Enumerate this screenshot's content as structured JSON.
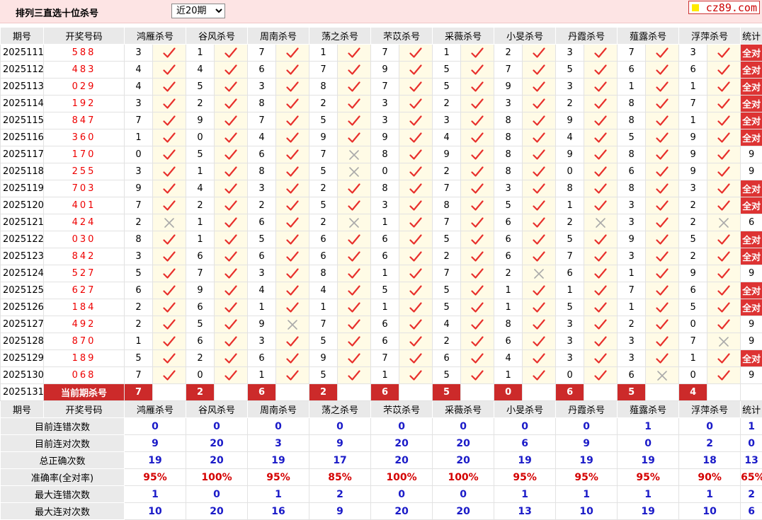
{
  "title": "排列三直选十位杀号",
  "period_select": {
    "value": "近20期",
    "options": [
      "近20期"
    ]
  },
  "logo": "cz89.com",
  "header": {
    "period": "期号",
    "draw": "开奖号码",
    "experts": [
      "鸿雁杀号",
      "谷风杀号",
      "周南杀号",
      "荡之杀号",
      "芣苡杀号",
      "采薇杀号",
      "小旻杀号",
      "丹霞杀号",
      "薤露杀号",
      "浮萍杀号"
    ],
    "stat": "统计"
  },
  "rows": [
    {
      "period": "2025111",
      "draw": "588",
      "kills": [
        [
          "3",
          true
        ],
        [
          "1",
          true
        ],
        [
          "7",
          true
        ],
        [
          "1",
          true
        ],
        [
          "7",
          true
        ],
        [
          "1",
          true
        ],
        [
          "2",
          true
        ],
        [
          "3",
          true
        ],
        [
          "7",
          true
        ],
        [
          "3",
          true
        ]
      ],
      "stat": "全对"
    },
    {
      "period": "2025112",
      "draw": "483",
      "kills": [
        [
          "4",
          true
        ],
        [
          "4",
          true
        ],
        [
          "6",
          true
        ],
        [
          "7",
          true
        ],
        [
          "9",
          true
        ],
        [
          "5",
          true
        ],
        [
          "7",
          true
        ],
        [
          "5",
          true
        ],
        [
          "6",
          true
        ],
        [
          "6",
          true
        ]
      ],
      "stat": "全对"
    },
    {
      "period": "2025113",
      "draw": "029",
      "kills": [
        [
          "4",
          true
        ],
        [
          "5",
          true
        ],
        [
          "3",
          true
        ],
        [
          "8",
          true
        ],
        [
          "7",
          true
        ],
        [
          "5",
          true
        ],
        [
          "9",
          true
        ],
        [
          "3",
          true
        ],
        [
          "1",
          true
        ],
        [
          "1",
          true
        ]
      ],
      "stat": "全对"
    },
    {
      "period": "2025114",
      "draw": "192",
      "kills": [
        [
          "3",
          true
        ],
        [
          "2",
          true
        ],
        [
          "8",
          true
        ],
        [
          "2",
          true
        ],
        [
          "3",
          true
        ],
        [
          "2",
          true
        ],
        [
          "3",
          true
        ],
        [
          "2",
          true
        ],
        [
          "8",
          true
        ],
        [
          "7",
          true
        ]
      ],
      "stat": "全对"
    },
    {
      "period": "2025115",
      "draw": "847",
      "kills": [
        [
          "7",
          true
        ],
        [
          "9",
          true
        ],
        [
          "7",
          true
        ],
        [
          "5",
          true
        ],
        [
          "3",
          true
        ],
        [
          "3",
          true
        ],
        [
          "8",
          true
        ],
        [
          "9",
          true
        ],
        [
          "8",
          true
        ],
        [
          "1",
          true
        ]
      ],
      "stat": "全对"
    },
    {
      "period": "2025116",
      "draw": "360",
      "kills": [
        [
          "1",
          true
        ],
        [
          "0",
          true
        ],
        [
          "4",
          true
        ],
        [
          "9",
          true
        ],
        [
          "9",
          true
        ],
        [
          "4",
          true
        ],
        [
          "8",
          true
        ],
        [
          "4",
          true
        ],
        [
          "5",
          true
        ],
        [
          "9",
          true
        ]
      ],
      "stat": "全对"
    },
    {
      "period": "2025117",
      "draw": "170",
      "kills": [
        [
          "0",
          true
        ],
        [
          "5",
          true
        ],
        [
          "6",
          true
        ],
        [
          "7",
          false
        ],
        [
          "8",
          true
        ],
        [
          "9",
          true
        ],
        [
          "8",
          true
        ],
        [
          "9",
          true
        ],
        [
          "8",
          true
        ],
        [
          "9",
          true
        ]
      ],
      "stat": "9"
    },
    {
      "period": "2025118",
      "draw": "255",
      "kills": [
        [
          "3",
          true
        ],
        [
          "1",
          true
        ],
        [
          "8",
          true
        ],
        [
          "5",
          false
        ],
        [
          "0",
          true
        ],
        [
          "2",
          true
        ],
        [
          "8",
          true
        ],
        [
          "0",
          true
        ],
        [
          "6",
          true
        ],
        [
          "9",
          true
        ]
      ],
      "stat": "9"
    },
    {
      "period": "2025119",
      "draw": "703",
      "kills": [
        [
          "9",
          true
        ],
        [
          "4",
          true
        ],
        [
          "3",
          true
        ],
        [
          "2",
          true
        ],
        [
          "8",
          true
        ],
        [
          "7",
          true
        ],
        [
          "3",
          true
        ],
        [
          "8",
          true
        ],
        [
          "8",
          true
        ],
        [
          "3",
          true
        ]
      ],
      "stat": "全对"
    },
    {
      "period": "2025120",
      "draw": "401",
      "kills": [
        [
          "7",
          true
        ],
        [
          "2",
          true
        ],
        [
          "2",
          true
        ],
        [
          "5",
          true
        ],
        [
          "3",
          true
        ],
        [
          "8",
          true
        ],
        [
          "5",
          true
        ],
        [
          "1",
          true
        ],
        [
          "3",
          true
        ],
        [
          "2",
          true
        ]
      ],
      "stat": "全对"
    },
    {
      "period": "2025121",
      "draw": "424",
      "kills": [
        [
          "2",
          false
        ],
        [
          "1",
          true
        ],
        [
          "6",
          true
        ],
        [
          "2",
          false
        ],
        [
          "1",
          true
        ],
        [
          "7",
          true
        ],
        [
          "6",
          true
        ],
        [
          "2",
          false
        ],
        [
          "3",
          true
        ],
        [
          "2",
          false
        ]
      ],
      "stat": "6"
    },
    {
      "period": "2025122",
      "draw": "030",
      "kills": [
        [
          "8",
          true
        ],
        [
          "1",
          true
        ],
        [
          "5",
          true
        ],
        [
          "6",
          true
        ],
        [
          "6",
          true
        ],
        [
          "5",
          true
        ],
        [
          "6",
          true
        ],
        [
          "5",
          true
        ],
        [
          "9",
          true
        ],
        [
          "5",
          true
        ]
      ],
      "stat": "全对"
    },
    {
      "period": "2025123",
      "draw": "842",
      "kills": [
        [
          "3",
          true
        ],
        [
          "6",
          true
        ],
        [
          "6",
          true
        ],
        [
          "6",
          true
        ],
        [
          "6",
          true
        ],
        [
          "2",
          true
        ],
        [
          "6",
          true
        ],
        [
          "7",
          true
        ],
        [
          "3",
          true
        ],
        [
          "2",
          true
        ]
      ],
      "stat": "全对"
    },
    {
      "period": "2025124",
      "draw": "527",
      "kills": [
        [
          "5",
          true
        ],
        [
          "7",
          true
        ],
        [
          "3",
          true
        ],
        [
          "8",
          true
        ],
        [
          "1",
          true
        ],
        [
          "7",
          true
        ],
        [
          "2",
          false
        ],
        [
          "6",
          true
        ],
        [
          "1",
          true
        ],
        [
          "9",
          true
        ]
      ],
      "stat": "9"
    },
    {
      "period": "2025125",
      "draw": "627",
      "kills": [
        [
          "6",
          true
        ],
        [
          "9",
          true
        ],
        [
          "4",
          true
        ],
        [
          "4",
          true
        ],
        [
          "5",
          true
        ],
        [
          "5",
          true
        ],
        [
          "1",
          true
        ],
        [
          "1",
          true
        ],
        [
          "7",
          true
        ],
        [
          "6",
          true
        ]
      ],
      "stat": "全对"
    },
    {
      "period": "2025126",
      "draw": "184",
      "kills": [
        [
          "2",
          true
        ],
        [
          "6",
          true
        ],
        [
          "1",
          true
        ],
        [
          "1",
          true
        ],
        [
          "1",
          true
        ],
        [
          "5",
          true
        ],
        [
          "1",
          true
        ],
        [
          "5",
          true
        ],
        [
          "1",
          true
        ],
        [
          "5",
          true
        ]
      ],
      "stat": "全对"
    },
    {
      "period": "2025127",
      "draw": "492",
      "kills": [
        [
          "2",
          true
        ],
        [
          "5",
          true
        ],
        [
          "9",
          false
        ],
        [
          "7",
          true
        ],
        [
          "6",
          true
        ],
        [
          "4",
          true
        ],
        [
          "8",
          true
        ],
        [
          "3",
          true
        ],
        [
          "2",
          true
        ],
        [
          "0",
          true
        ]
      ],
      "stat": "9"
    },
    {
      "period": "2025128",
      "draw": "870",
      "kills": [
        [
          "1",
          true
        ],
        [
          "6",
          true
        ],
        [
          "3",
          true
        ],
        [
          "5",
          true
        ],
        [
          "6",
          true
        ],
        [
          "2",
          true
        ],
        [
          "6",
          true
        ],
        [
          "3",
          true
        ],
        [
          "3",
          true
        ],
        [
          "7",
          false
        ]
      ],
      "stat": "9"
    },
    {
      "period": "2025129",
      "draw": "189",
      "kills": [
        [
          "5",
          true
        ],
        [
          "2",
          true
        ],
        [
          "6",
          true
        ],
        [
          "9",
          true
        ],
        [
          "7",
          true
        ],
        [
          "6",
          true
        ],
        [
          "4",
          true
        ],
        [
          "3",
          true
        ],
        [
          "3",
          true
        ],
        [
          "1",
          true
        ]
      ],
      "stat": "全对"
    },
    {
      "period": "2025130",
      "draw": "068",
      "kills": [
        [
          "7",
          true
        ],
        [
          "0",
          true
        ],
        [
          "1",
          true
        ],
        [
          "5",
          true
        ],
        [
          "1",
          true
        ],
        [
          "5",
          true
        ],
        [
          "1",
          true
        ],
        [
          "0",
          true
        ],
        [
          "6",
          false
        ],
        [
          "0",
          true
        ]
      ],
      "stat": "9"
    }
  ],
  "current": {
    "period": "2025131",
    "label": "当前期杀号",
    "kills": [
      "7",
      "2",
      "6",
      "2",
      "6",
      "5",
      "0",
      "6",
      "5",
      "4"
    ]
  },
  "stats": [
    {
      "label": "目前连错次数",
      "values": [
        "0",
        "0",
        "0",
        "0",
        "0",
        "0",
        "0",
        "0",
        "1",
        "0",
        "1"
      ],
      "red": false
    },
    {
      "label": "目前连对次数",
      "values": [
        "9",
        "20",
        "3",
        "9",
        "20",
        "20",
        "6",
        "9",
        "0",
        "2",
        "0"
      ],
      "red": false
    },
    {
      "label": "总正确次数",
      "values": [
        "19",
        "20",
        "19",
        "17",
        "20",
        "20",
        "19",
        "19",
        "19",
        "18",
        "13"
      ],
      "red": false
    },
    {
      "label": "准确率(全对率)",
      "values": [
        "95%",
        "100%",
        "95%",
        "85%",
        "100%",
        "100%",
        "95%",
        "95%",
        "95%",
        "90%",
        "65%"
      ],
      "red": true
    },
    {
      "label": "最大连错次数",
      "values": [
        "1",
        "0",
        "1",
        "2",
        "0",
        "0",
        "1",
        "1",
        "1",
        "1",
        "2"
      ],
      "red": false
    },
    {
      "label": "最大连对次数",
      "values": [
        "10",
        "20",
        "16",
        "9",
        "20",
        "20",
        "13",
        "10",
        "19",
        "10",
        "6"
      ],
      "red": false
    }
  ]
}
